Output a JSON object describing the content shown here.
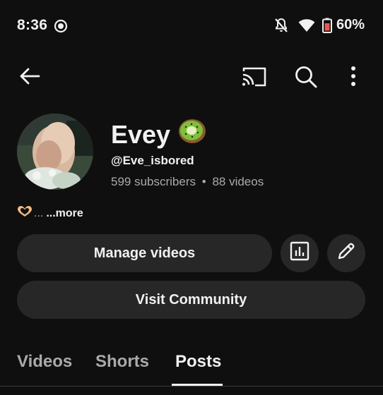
{
  "status_bar": {
    "time": "8:36",
    "battery": "60%",
    "icons": [
      "screen-record-icon",
      "notifications-off-icon",
      "wifi-icon",
      "battery-low-icon"
    ]
  },
  "app_bar": {
    "icons": [
      "back-arrow-icon",
      "cast-icon",
      "search-icon",
      "more-vert-icon"
    ]
  },
  "channel": {
    "name": "Evey",
    "name_emoji": "kiwi-icon",
    "handle": "@Eve_isbored",
    "subscribers": "599 subscribers",
    "separator": "•",
    "videos": "88 videos",
    "description_ellipsis": "...",
    "more_label": "...more"
  },
  "actions": {
    "manage_videos": "Manage videos",
    "analytics_icon": "analytics-icon",
    "edit_icon": "pencil-icon",
    "visit_community": "Visit Community"
  },
  "tabs": [
    {
      "label": "Videos",
      "active": false
    },
    {
      "label": "Shorts",
      "active": false
    },
    {
      "label": "Posts",
      "active": true
    }
  ],
  "colors": {
    "background": "#0f0f0f",
    "button": "#272727",
    "text_primary": "#f1f1f1",
    "text_secondary": "#aaaaaa",
    "battery_accent": "#e8584f"
  }
}
